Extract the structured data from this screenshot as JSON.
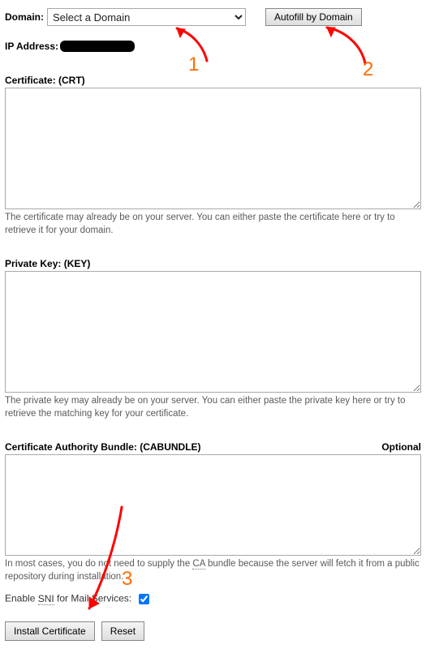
{
  "domain_row": {
    "label": "Domain:",
    "selected_option": "Select a Domain",
    "autofill_label": "Autofill by Domain"
  },
  "ip_row": {
    "label": "IP Address:"
  },
  "crt_section": {
    "label": "Certificate: (CRT)",
    "value": "",
    "help": "The certificate may already be on your server. You can either paste the certificate here or try to retrieve it for your domain."
  },
  "key_section": {
    "label": "Private Key: (KEY)",
    "value": "",
    "help": "The private key may already be on your server. You can either paste the private key here or try to retrieve the matching key for your certificate."
  },
  "cab_section": {
    "label": "Certificate Authority Bundle: (CABUNDLE)",
    "optional": "Optional",
    "value": "",
    "help_pre": "In most cases, you do not need to supply the ",
    "help_abbr": "CA",
    "help_post": " bundle because the server will fetch it from a public repository during installation."
  },
  "sni_row": {
    "pre": "Enable ",
    "abbr": "SNI",
    "post": " for Mail Services:",
    "checked": true
  },
  "actions": {
    "install": "Install Certificate",
    "reset": "Reset"
  },
  "annotations": {
    "n1": "1",
    "n2": "2",
    "n3": "3"
  }
}
